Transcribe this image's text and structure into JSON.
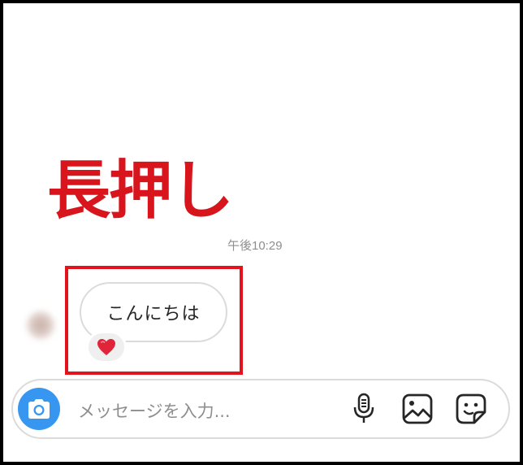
{
  "annotation": {
    "text": "長押し",
    "color": "#d8141c"
  },
  "conversation": {
    "timestamp": "午後10:29",
    "message": {
      "text": "こんにちは",
      "reaction": "❤️"
    }
  },
  "highlight": {
    "color": "#e3131b"
  },
  "composer": {
    "placeholder": "メッセージを入力...",
    "camera_icon": "camera-icon",
    "tools": [
      "microphone-icon",
      "gallery-icon",
      "sticker-icon"
    ],
    "accent": "#3797f0"
  }
}
